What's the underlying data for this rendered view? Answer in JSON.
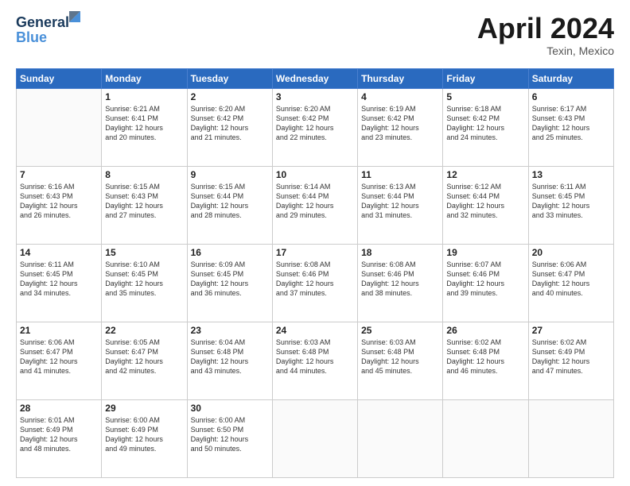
{
  "header": {
    "logo_line1": "General",
    "logo_line2": "Blue",
    "title": "April 2024",
    "location": "Texin, Mexico"
  },
  "days_of_week": [
    "Sunday",
    "Monday",
    "Tuesday",
    "Wednesday",
    "Thursday",
    "Friday",
    "Saturday"
  ],
  "weeks": [
    [
      {
        "day": "",
        "info": ""
      },
      {
        "day": "1",
        "info": "Sunrise: 6:21 AM\nSunset: 6:41 PM\nDaylight: 12 hours\nand 20 minutes."
      },
      {
        "day": "2",
        "info": "Sunrise: 6:20 AM\nSunset: 6:42 PM\nDaylight: 12 hours\nand 21 minutes."
      },
      {
        "day": "3",
        "info": "Sunrise: 6:20 AM\nSunset: 6:42 PM\nDaylight: 12 hours\nand 22 minutes."
      },
      {
        "day": "4",
        "info": "Sunrise: 6:19 AM\nSunset: 6:42 PM\nDaylight: 12 hours\nand 23 minutes."
      },
      {
        "day": "5",
        "info": "Sunrise: 6:18 AM\nSunset: 6:42 PM\nDaylight: 12 hours\nand 24 minutes."
      },
      {
        "day": "6",
        "info": "Sunrise: 6:17 AM\nSunset: 6:43 PM\nDaylight: 12 hours\nand 25 minutes."
      }
    ],
    [
      {
        "day": "7",
        "info": "Sunrise: 6:16 AM\nSunset: 6:43 PM\nDaylight: 12 hours\nand 26 minutes."
      },
      {
        "day": "8",
        "info": "Sunrise: 6:15 AM\nSunset: 6:43 PM\nDaylight: 12 hours\nand 27 minutes."
      },
      {
        "day": "9",
        "info": "Sunrise: 6:15 AM\nSunset: 6:44 PM\nDaylight: 12 hours\nand 28 minutes."
      },
      {
        "day": "10",
        "info": "Sunrise: 6:14 AM\nSunset: 6:44 PM\nDaylight: 12 hours\nand 29 minutes."
      },
      {
        "day": "11",
        "info": "Sunrise: 6:13 AM\nSunset: 6:44 PM\nDaylight: 12 hours\nand 31 minutes."
      },
      {
        "day": "12",
        "info": "Sunrise: 6:12 AM\nSunset: 6:44 PM\nDaylight: 12 hours\nand 32 minutes."
      },
      {
        "day": "13",
        "info": "Sunrise: 6:11 AM\nSunset: 6:45 PM\nDaylight: 12 hours\nand 33 minutes."
      }
    ],
    [
      {
        "day": "14",
        "info": "Sunrise: 6:11 AM\nSunset: 6:45 PM\nDaylight: 12 hours\nand 34 minutes."
      },
      {
        "day": "15",
        "info": "Sunrise: 6:10 AM\nSunset: 6:45 PM\nDaylight: 12 hours\nand 35 minutes."
      },
      {
        "day": "16",
        "info": "Sunrise: 6:09 AM\nSunset: 6:45 PM\nDaylight: 12 hours\nand 36 minutes."
      },
      {
        "day": "17",
        "info": "Sunrise: 6:08 AM\nSunset: 6:46 PM\nDaylight: 12 hours\nand 37 minutes."
      },
      {
        "day": "18",
        "info": "Sunrise: 6:08 AM\nSunset: 6:46 PM\nDaylight: 12 hours\nand 38 minutes."
      },
      {
        "day": "19",
        "info": "Sunrise: 6:07 AM\nSunset: 6:46 PM\nDaylight: 12 hours\nand 39 minutes."
      },
      {
        "day": "20",
        "info": "Sunrise: 6:06 AM\nSunset: 6:47 PM\nDaylight: 12 hours\nand 40 minutes."
      }
    ],
    [
      {
        "day": "21",
        "info": "Sunrise: 6:06 AM\nSunset: 6:47 PM\nDaylight: 12 hours\nand 41 minutes."
      },
      {
        "day": "22",
        "info": "Sunrise: 6:05 AM\nSunset: 6:47 PM\nDaylight: 12 hours\nand 42 minutes."
      },
      {
        "day": "23",
        "info": "Sunrise: 6:04 AM\nSunset: 6:48 PM\nDaylight: 12 hours\nand 43 minutes."
      },
      {
        "day": "24",
        "info": "Sunrise: 6:03 AM\nSunset: 6:48 PM\nDaylight: 12 hours\nand 44 minutes."
      },
      {
        "day": "25",
        "info": "Sunrise: 6:03 AM\nSunset: 6:48 PM\nDaylight: 12 hours\nand 45 minutes."
      },
      {
        "day": "26",
        "info": "Sunrise: 6:02 AM\nSunset: 6:48 PM\nDaylight: 12 hours\nand 46 minutes."
      },
      {
        "day": "27",
        "info": "Sunrise: 6:02 AM\nSunset: 6:49 PM\nDaylight: 12 hours\nand 47 minutes."
      }
    ],
    [
      {
        "day": "28",
        "info": "Sunrise: 6:01 AM\nSunset: 6:49 PM\nDaylight: 12 hours\nand 48 minutes."
      },
      {
        "day": "29",
        "info": "Sunrise: 6:00 AM\nSunset: 6:49 PM\nDaylight: 12 hours\nand 49 minutes."
      },
      {
        "day": "30",
        "info": "Sunrise: 6:00 AM\nSunset: 6:50 PM\nDaylight: 12 hours\nand 50 minutes."
      },
      {
        "day": "",
        "info": ""
      },
      {
        "day": "",
        "info": ""
      },
      {
        "day": "",
        "info": ""
      },
      {
        "day": "",
        "info": ""
      }
    ]
  ]
}
